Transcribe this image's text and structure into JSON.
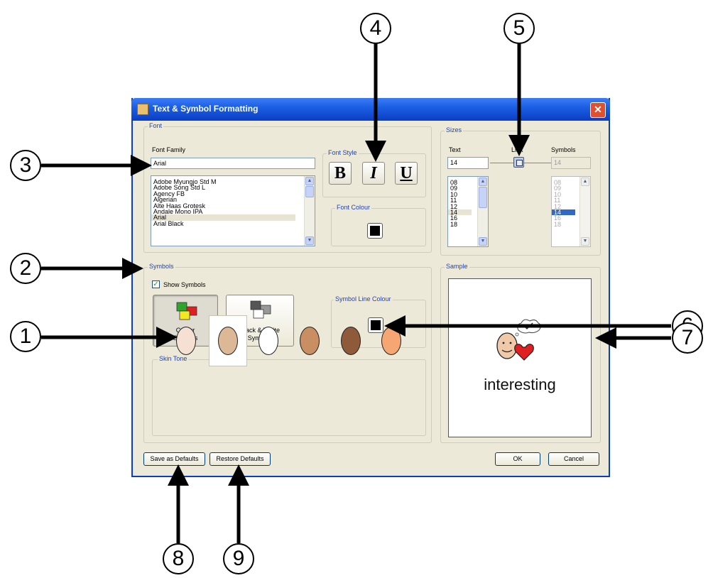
{
  "dialog": {
    "title": "Text & Symbol Formatting",
    "close_glyph": "✕"
  },
  "font": {
    "legend": "Font",
    "family_label": "Font Family",
    "family_value": "Arial",
    "family_list": [
      "Adobe Myungjo Std M",
      "Adobe Song Std L",
      "Agency FB",
      "Algerian",
      "Alte Haas Grotesk",
      "Andale Mono IPA",
      "Arial",
      "Arial Black"
    ],
    "family_selected": "Arial",
    "style_legend": "Font Style",
    "bold": "B",
    "italic": "I",
    "underline": "U",
    "colour_legend": "Font Colour",
    "colour": "#000000"
  },
  "sizes": {
    "legend": "Sizes",
    "text_label": "Text",
    "link_label": "Link",
    "symbols_label": "Symbols",
    "text_value": "14",
    "symbols_value": "14",
    "text_list": [
      "08",
      "09",
      "10",
      "11",
      "12",
      "14",
      "16",
      "18"
    ],
    "symbols_list": [
      "08",
      "09",
      "10",
      "11",
      "12",
      "14",
      "16",
      "18"
    ],
    "selected": "14"
  },
  "symbols": {
    "legend": "Symbols",
    "show_label": "Show Symbols",
    "show_checked": true,
    "colour_btn_line1": "Colour",
    "colour_btn_line2": "Symbols",
    "bw_btn_line1": "Black & White",
    "bw_btn_line2": "Symbols",
    "line_colour_legend": "Symbol Line Colour",
    "line_colour": "#000000",
    "skin_legend": "Skin Tone",
    "skin_tones": [
      "#f6e0d4",
      "#dcb896",
      "#ffffff",
      "#c98f62",
      "#8e5a3a",
      "#f5a672"
    ],
    "skin_selected_index": 1
  },
  "sample": {
    "legend": "Sample",
    "word": "interesting"
  },
  "buttons": {
    "save_defaults": "Save as Defaults",
    "restore_defaults": "Restore Defaults",
    "ok": "OK",
    "cancel": "Cancel"
  },
  "callouts": [
    "1",
    "2",
    "3",
    "4",
    "5",
    "6",
    "7",
    "8",
    "9"
  ]
}
